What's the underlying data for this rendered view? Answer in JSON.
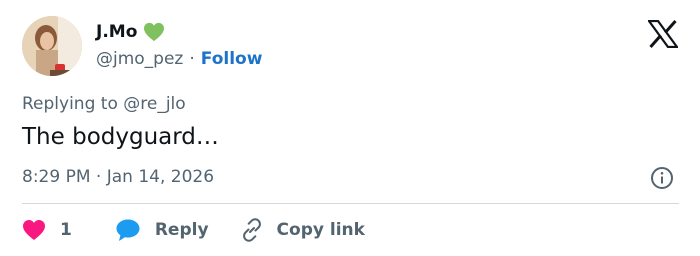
{
  "author": {
    "display_name": "J.Mo",
    "handle": "@jmo_pez",
    "separator": "·",
    "follow_label": "Follow",
    "badge_icon": "green-heart-icon"
  },
  "reply_context": {
    "prefix": "Replying to",
    "mention": "@re_jlo"
  },
  "tweet": {
    "text": "The bodyguard…",
    "timestamp": "8:29 PM · Jan 14, 2026"
  },
  "actions": {
    "like_count": "1",
    "reply_label": "Reply",
    "copy_link_label": "Copy link"
  },
  "icons": {
    "brand": "x-logo-icon",
    "info": "info-icon",
    "like": "heart-icon",
    "reply": "speech-bubble-icon",
    "copy": "link-icon"
  },
  "colors": {
    "text_primary": "#0f1419",
    "text_secondary": "#536471",
    "link": "#1d73c9",
    "like_pink": "#f91880",
    "reply_blue": "#1d9bf0",
    "badge_green": "#7fc15e",
    "divider": "#cfd9de"
  }
}
